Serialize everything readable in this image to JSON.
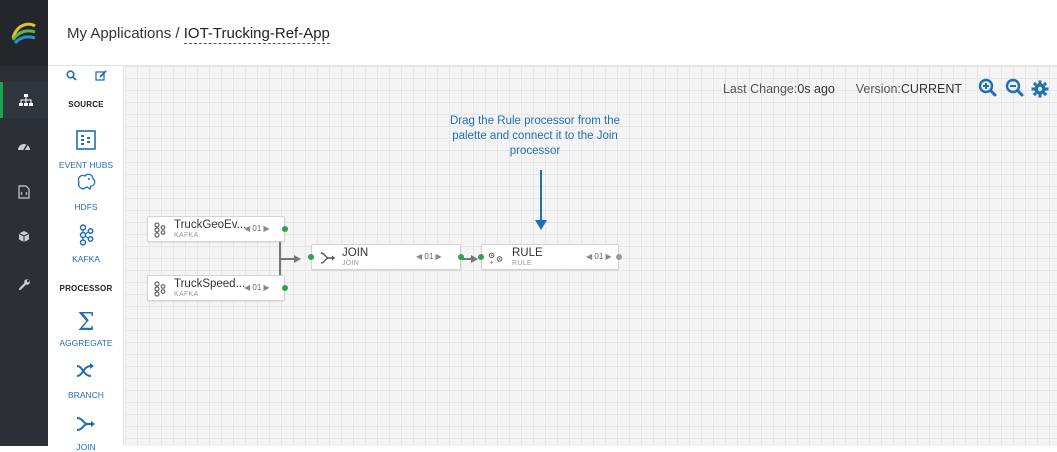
{
  "header": {
    "breadcrumb_root": "My Applications",
    "breadcrumb_separator": " / ",
    "app_name": "IOT-Trucking-Ref-App"
  },
  "palette": {
    "sections": [
      {
        "title": "SOURCE",
        "items": [
          {
            "label": "EVENT HUBS",
            "icon": "event-hubs-icon"
          },
          {
            "label": "HDFS",
            "icon": "hdfs-icon"
          },
          {
            "label": "KAFKA",
            "icon": "kafka-icon"
          }
        ]
      },
      {
        "title": "PROCESSOR",
        "items": [
          {
            "label": "AGGREGATE",
            "icon": "sigma-icon"
          },
          {
            "label": "BRANCH",
            "icon": "branch-icon"
          },
          {
            "label": "JOIN",
            "icon": "join-icon"
          }
        ]
      }
    ]
  },
  "status": {
    "last_change_label": "Last Change:",
    "last_change_value": "0s ago",
    "version_label": "Version:",
    "version_value": "CURRENT"
  },
  "hint": "Drag the Rule processor from the palette and connect it to the Join processor",
  "nodes": [
    {
      "title": "TruckGeoEv...",
      "subtitle": "KAFKA",
      "count": "01"
    },
    {
      "title": "TruckSpeed...",
      "subtitle": "KAFKA",
      "count": "01"
    },
    {
      "title": "JOIN",
      "subtitle": "JOIN",
      "count": "01"
    },
    {
      "title": "RULE",
      "subtitle": "RULE",
      "count": "01"
    }
  ],
  "colors": {
    "accent_blue": "#1f6fb8",
    "port_green": "#2ea44f",
    "rail_dark": "#2b3036"
  }
}
